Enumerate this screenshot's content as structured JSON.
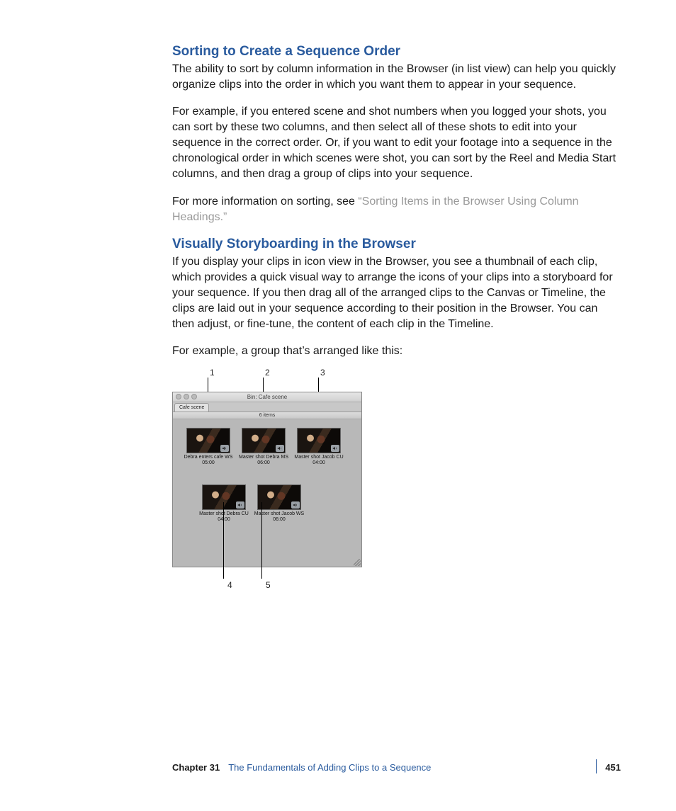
{
  "sections": {
    "s1": {
      "heading": "Sorting to Create a Sequence Order",
      "p1": "The ability to sort by column information in the Browser (in list view) can help you quickly organize clips into the order in which you want them to appear in your sequence.",
      "p2": "For example, if you entered scene and shot numbers when you logged your shots, you can sort by these two columns, and then select all of these shots to edit into your sequence in the correct order. Or, if you want to edit your footage into a sequence in the chronological order in which scenes were shot, you can sort by the Reel and Media Start columns, and then drag a group of clips into your sequence.",
      "p3_lead": "For more information on sorting, see ",
      "p3_xref": "“Sorting Items in the Browser Using Column Headings.”"
    },
    "s2": {
      "heading": "Visually Storyboarding in the Browser",
      "p1": "If you display your clips in icon view in the Browser, you see a thumbnail of each clip, which provides a quick visual way to arrange the icons of your clips into a storyboard for your sequence. If you then drag all of the arranged clips to the Canvas or Timeline, the clips are laid out in your sequence according to their position in the Browser. You can then adjust, or fine-tune, the content of each clip in the Timeline.",
      "p2": "For example, a group that’s arranged like this:"
    }
  },
  "bin": {
    "title": "Bin: Cafe scene",
    "tab": "Cafe scene",
    "count": "6 items",
    "clips": [
      {
        "label": "Debra enters cafe WS",
        "time": "05:00"
      },
      {
        "label": "Master shot Debra MS",
        "time": "06:00"
      },
      {
        "label": "Master shot Jacob CU",
        "time": "04:00"
      },
      {
        "label": "Master shot Debra CU",
        "time": "04:00"
      },
      {
        "label": "Master shot Jacob WS",
        "time": "06:00"
      }
    ]
  },
  "callouts": {
    "c1": "1",
    "c2": "2",
    "c3": "3",
    "c4": "4",
    "c5": "5"
  },
  "footer": {
    "chapter": "Chapter 31",
    "title": "The Fundamentals of Adding Clips to a Sequence",
    "page": "451"
  }
}
